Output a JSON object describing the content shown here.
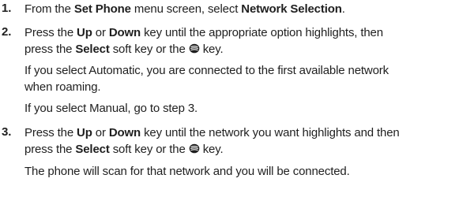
{
  "steps": [
    {
      "number": "1.",
      "t1": "From the ",
      "b1": "Set Phone",
      "t2": " menu screen, select ",
      "b2": "Network Selection",
      "t3": "."
    },
    {
      "number": "2.",
      "line1": {
        "t1": "Press the ",
        "b1": "Up",
        "t2": " or ",
        "b2": "Down",
        "t3": " key until the appropriate option highlights, then"
      },
      "line2": {
        "t1": "press the ",
        "b1": "Select",
        "t2": " soft key or the ",
        "t3": " key."
      },
      "note1_line1": "If you select Automatic, you are connected to the first available network",
      "note1_line2": "when roaming.",
      "note2": "If you select Manual, go to step 3."
    },
    {
      "number": "3.",
      "line1": {
        "t1": "Press the ",
        "b1": "Up",
        "t2": " or ",
        "b2": "Down",
        "t3": " key until the network you want highlights and then"
      },
      "line2": {
        "t1": "press the ",
        "b1": "Select",
        "t2": " soft key or the ",
        "t3": " key."
      },
      "note": "The phone will scan for that network and you will be connected."
    }
  ],
  "icons": {
    "select_key": "ok-key-icon"
  }
}
